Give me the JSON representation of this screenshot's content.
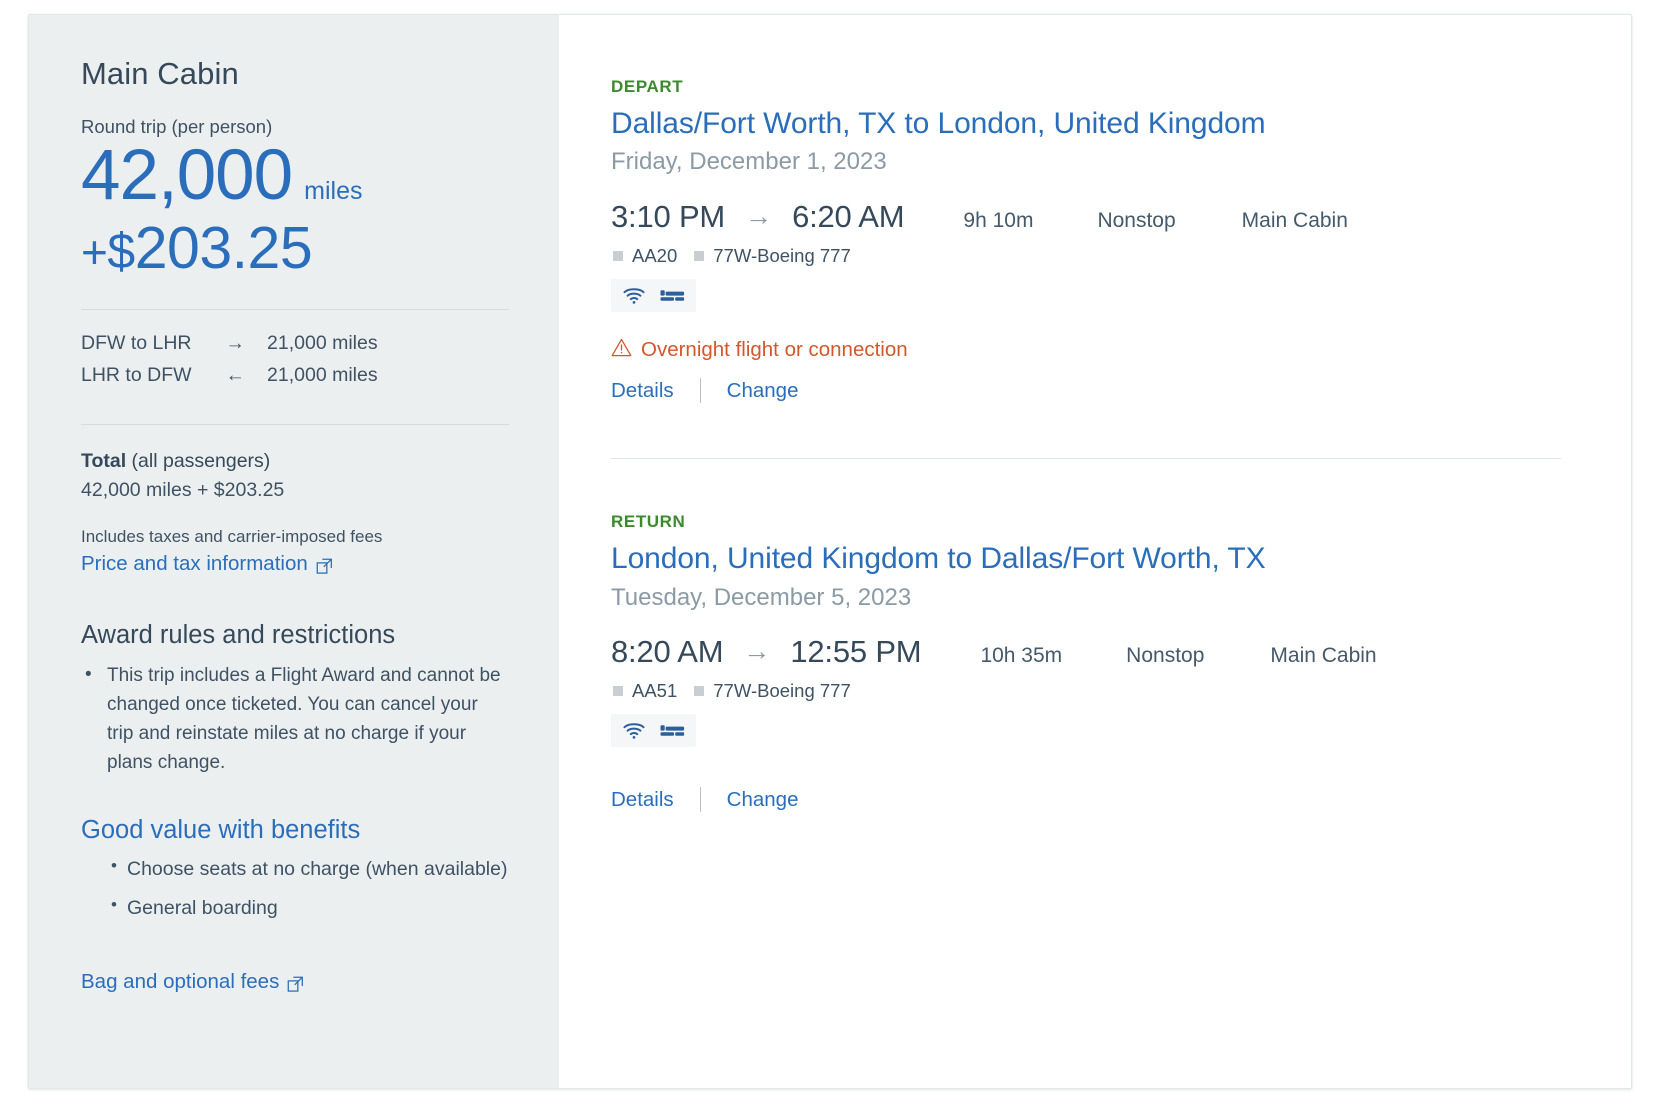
{
  "sidebar": {
    "cabin_title": "Main Cabin",
    "roundtrip_label": "Round trip (per person)",
    "miles_value": "42,000",
    "miles_unit": "miles",
    "cash_plus": "+",
    "cash_dollar": "$",
    "cash_value": "203.25",
    "legs": [
      {
        "route": "DFW to LHR",
        "arrow": "→",
        "miles": "21,000 miles"
      },
      {
        "route": "LHR to DFW",
        "arrow": "←",
        "miles": "21,000 miles"
      }
    ],
    "total_label_bold": "Total",
    "total_label_rest": " (all passengers)",
    "total_amount": "42,000 miles + $203.25",
    "includes_note": "Includes taxes and carrier-imposed fees",
    "price_tax_link": "Price and tax information",
    "rules_title": "Award rules and restrictions",
    "rules": [
      "This trip includes a Flight Award and cannot be changed once ticketed. You can cancel your trip and reinstate miles at no charge if your plans change."
    ],
    "benefits_title": "Good value with benefits",
    "benefits": [
      "Choose seats at no charge (when available)",
      "General boarding"
    ],
    "bag_fees_link": "Bag and optional fees"
  },
  "segments": [
    {
      "label": "DEPART",
      "route": "Dallas/Fort Worth, TX to London, United Kingdom",
      "date": "Friday, December 1, 2023",
      "depart_time": "3:10 PM",
      "arrow": "→",
      "arrive_time": "6:20 AM",
      "duration": "9h 10m",
      "stops": "Nonstop",
      "cabin": "Main Cabin",
      "flight_number": "AA20",
      "aircraft": "77W-Boeing 777",
      "amenities": [
        "wifi-icon",
        "lie-flat-seat-icon"
      ],
      "warning": "Overnight flight or connection",
      "details_label": "Details",
      "change_label": "Change"
    },
    {
      "label": "RETURN",
      "route": "London, United Kingdom to Dallas/Fort Worth, TX",
      "date": "Tuesday, December 5, 2023",
      "depart_time": "8:20 AM",
      "arrow": "→",
      "arrive_time": "12:55 PM",
      "duration": "10h 35m",
      "stops": "Nonstop",
      "cabin": "Main Cabin",
      "flight_number": "AA51",
      "aircraft": "77W-Boeing 777",
      "amenities": [
        "wifi-icon",
        "lie-flat-seat-icon"
      ],
      "warning": null,
      "details_label": "Details",
      "change_label": "Change"
    }
  ],
  "colors": {
    "accent_blue": "#2a6ebb",
    "heading_slate": "#36495a",
    "section_green": "#3c8a2e",
    "warning_orange": "#d4572a",
    "sidebar_bg": "#eceff0"
  }
}
